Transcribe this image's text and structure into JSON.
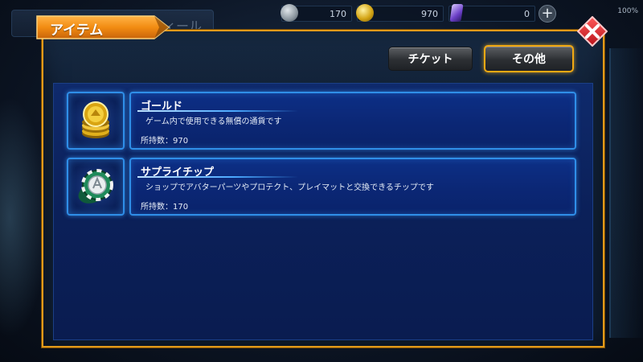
{
  "background": {
    "tab_label": "ィール"
  },
  "currency_bar": {
    "chip_count": "170",
    "gold_count": "970",
    "gem_count": "0",
    "plus_label": "+",
    "battery": "100%"
  },
  "dialog": {
    "title": "アイテム",
    "close_label": "✕",
    "tabs": [
      {
        "label": "チケット",
        "selected": false
      },
      {
        "label": "その他",
        "selected": true
      }
    ]
  },
  "items": [
    {
      "name": "ゴールド",
      "icon": "gold-coins-icon",
      "description": "ゲーム内で使用できる無償の通貨です",
      "count_text": "所持数：970"
    },
    {
      "name": "サプライチップ",
      "icon": "supply-chip-icon",
      "description": "ショップでアバターパーツやプロテクト、プレイマットと交換できるチップです",
      "count_text": "所持数：170"
    }
  ],
  "colors": {
    "dialog_border": "#e39a1a",
    "title_tab": "#f28c12",
    "close_button": "#d8232a",
    "item_panel": "#0b2775",
    "item_glow": "#2f8ee8"
  }
}
